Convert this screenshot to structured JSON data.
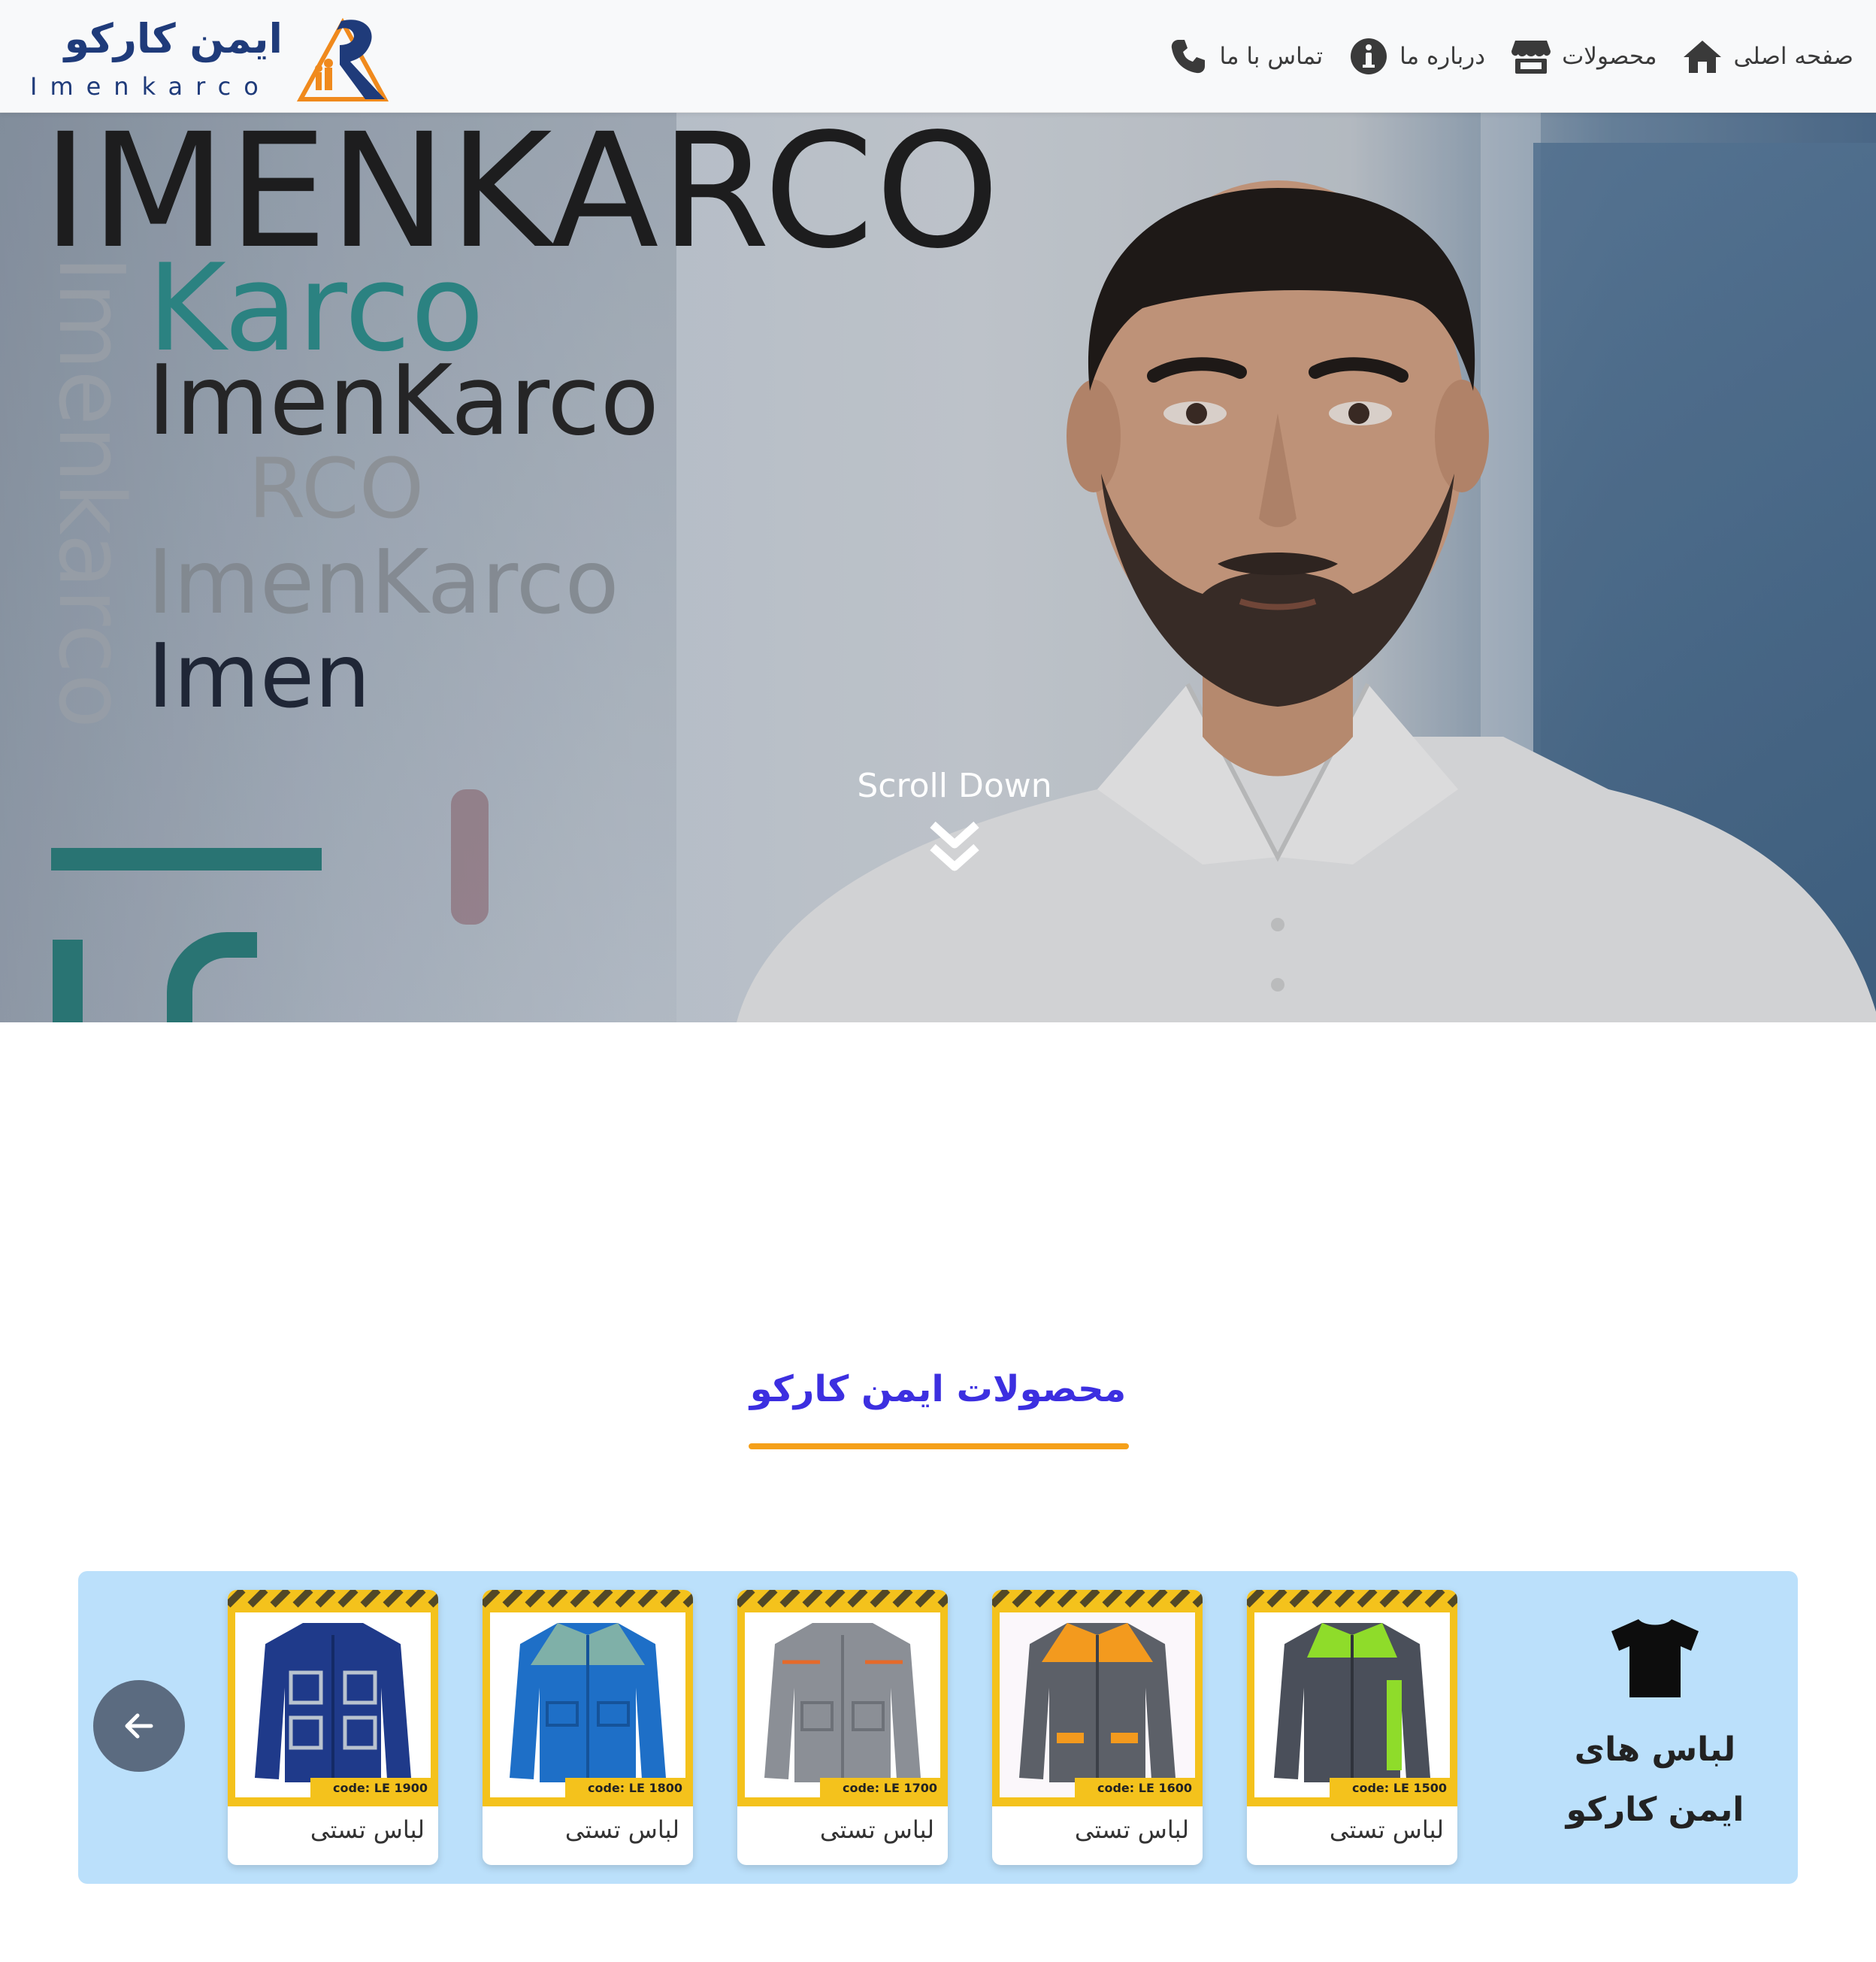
{
  "brand": {
    "name_fa": "ایمن کارکو",
    "name_en": "Imenkarco"
  },
  "nav": {
    "items": [
      {
        "label": "صفحه اصلی",
        "icon": "home-icon"
      },
      {
        "label": "محصولات",
        "icon": "store-icon"
      },
      {
        "label": "درباره ما",
        "icon": "info-icon"
      },
      {
        "label": "تماس با ما",
        "icon": "phone-icon"
      }
    ]
  },
  "hero": {
    "wordmarks": [
      "IMENKARCO",
      "Karco",
      "ImenKarco",
      "RCO",
      "ImenKarco",
      "Imen",
      "Imenkarco"
    ],
    "scroll_label": "Scroll Down"
  },
  "products_section": {
    "title": "محصولات ایمن کارکو",
    "category": {
      "title_line1": "لباس های",
      "title_line2": "ایمن کارکو",
      "icon": "tshirt-icon"
    },
    "items": [
      {
        "name": "لباس تستی",
        "code": "code: LE 1500",
        "jacket_color": "#4a4f5a",
        "accent_color": "#8fdc2a"
      },
      {
        "name": "لباس تستی",
        "code": "code: LE 1600",
        "jacket_color": "#5c6068",
        "accent_color": "#f39a1e"
      },
      {
        "name": "لباس تستی",
        "code": "code: LE 1700",
        "jacket_color": "#8b8f96",
        "accent_color": "#e56a2a"
      },
      {
        "name": "لباس تستی",
        "code": "code: LE 1800",
        "jacket_color": "#1e6fc7",
        "accent_color": "#7fb0a8"
      },
      {
        "name": "لباس تستی",
        "code": "code: LE 1900",
        "jacket_color": "#1f3a8a",
        "accent_color": "#b9c3cf"
      }
    ]
  },
  "colors": {
    "brand_blue": "#1f3b7a",
    "brand_orange": "#f08a1d",
    "title_purple": "#3c2fe0",
    "underline_orange": "#f5a01a",
    "strip_bg": "#bbe0fb"
  }
}
